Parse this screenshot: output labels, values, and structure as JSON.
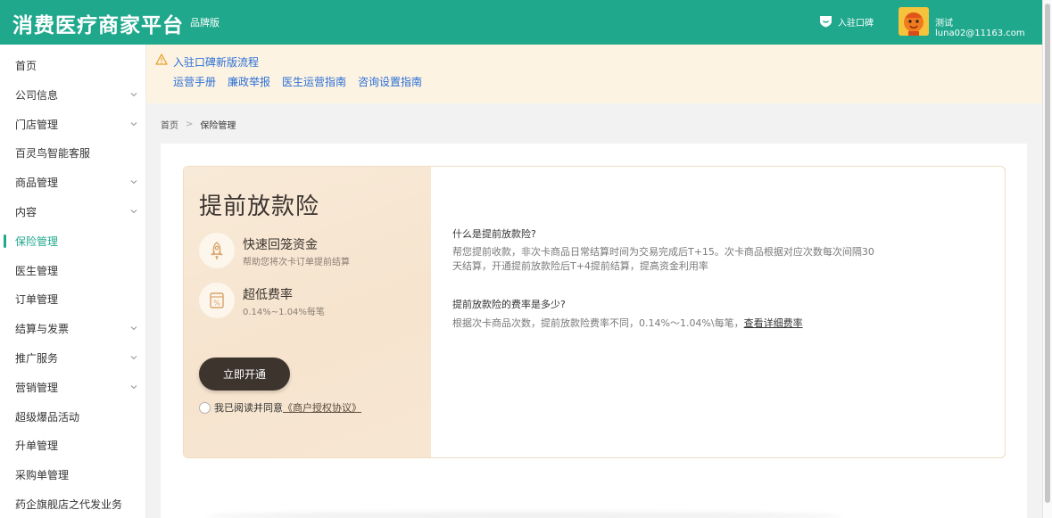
{
  "header": {
    "app_title": "消费医疗商家平台",
    "edition": "品牌版",
    "entry_label": "入驻口碑",
    "username": "测试luna02@11163.com"
  },
  "sidebar": {
    "items": [
      {
        "label": "首页",
        "has_arrow": false
      },
      {
        "label": "公司信息",
        "has_arrow": true
      },
      {
        "label": "门店管理",
        "has_arrow": true
      },
      {
        "label": "百灵鸟智能客服",
        "has_arrow": false
      },
      {
        "label": "商品管理",
        "has_arrow": true
      },
      {
        "label": "内容",
        "has_arrow": true
      },
      {
        "label": "保险管理",
        "has_arrow": false,
        "active": true
      },
      {
        "label": "医生管理",
        "has_arrow": false
      },
      {
        "label": "订单管理",
        "has_arrow": false
      },
      {
        "label": "结算与发票",
        "has_arrow": true
      },
      {
        "label": "推广服务",
        "has_arrow": true
      },
      {
        "label": "营销管理",
        "has_arrow": true
      },
      {
        "label": "超级爆品活动",
        "has_arrow": false
      },
      {
        "label": "升单管理",
        "has_arrow": false
      },
      {
        "label": "采购单管理",
        "has_arrow": false
      },
      {
        "label": "药企旗舰店之代发业务",
        "has_arrow": false
      }
    ]
  },
  "notice": {
    "title": "入驻口碑新版流程",
    "links": [
      "运营手册",
      "廉政举报",
      "医生运营指南",
      "咨询设置指南"
    ]
  },
  "breadcrumb": {
    "home": "首页",
    "separator": ">",
    "current": "保险管理"
  },
  "insurance": {
    "title": "提前放款险",
    "features": [
      {
        "icon": "rocket-icon",
        "title": "快速回笼资金",
        "desc": "帮助您将次卡订单提前结算"
      },
      {
        "icon": "percent-icon",
        "title": "超低费率",
        "desc": "0.14%~1.04%每笔"
      }
    ],
    "open_button": "立即开通",
    "agree_prefix": "我已阅读并同意",
    "agree_link": "《商户授权协议》"
  },
  "faq": {
    "q1": "什么是提前放款险?",
    "a1_line1": "帮您提前收款，非次卡商品日常结算时间为交易完成后T+15。次卡商品根据对应次数每次间隔30",
    "a1_line2": "天结算，开通提前放款险后T+4提前结算，提高资金利用率",
    "q2": "提前放款险的费率是多少?",
    "a2": "根据次卡商品次数，提前放款险费率不同，0.14%～1.04%\\每笔，",
    "a2_link": "查看详细费率"
  },
  "colors": {
    "brand": "#20a88d",
    "link": "#2b6fd6",
    "notice_bg": "#fcf3e3",
    "button_dark": "#3d342e"
  }
}
